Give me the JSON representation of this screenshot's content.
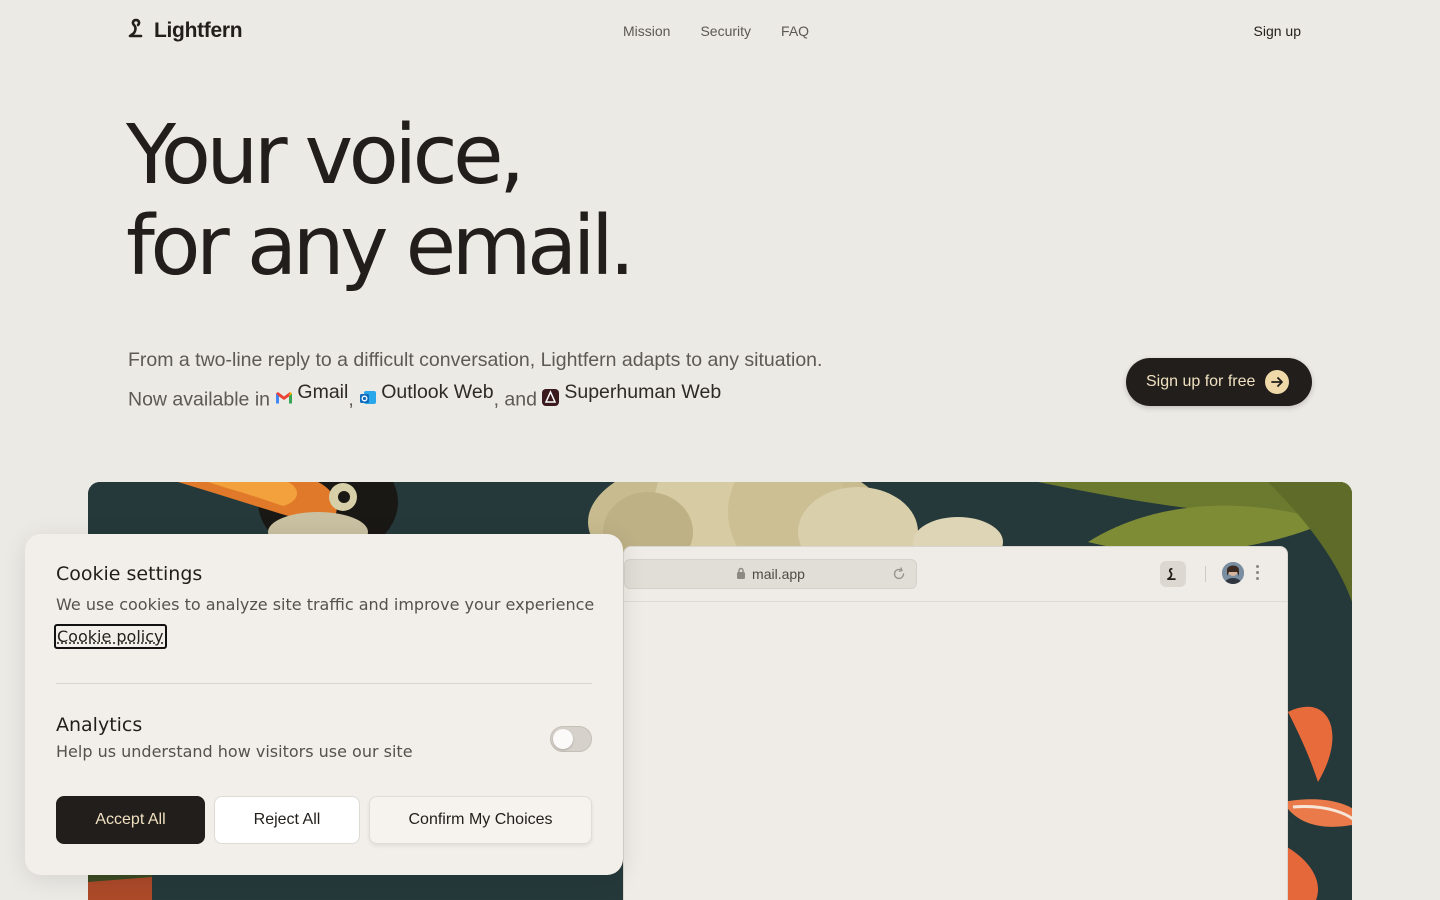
{
  "nav": {
    "logo_text": "Lightfern",
    "links": [
      "Mission",
      "Security",
      "FAQ"
    ],
    "signup": "Sign up"
  },
  "hero": {
    "title_line1": "Your voice,",
    "title_line2": "for any email.",
    "sub_line1": "From a two-line reply to a difficult conversation, Lightfern adapts to any situation.",
    "sub_prefix": "Now available in",
    "product1": "Gmail",
    "product2": "Outlook Web",
    "product3": "Superhuman Web",
    "cta": "Sign up for free"
  },
  "browser": {
    "url": "mail.app"
  },
  "cookie": {
    "title": "Cookie settings",
    "description": "We use cookies to analyze site traffic and improve your experience",
    "policy_link": "Cookie policy",
    "analytics_title": "Analytics",
    "analytics_description": "Help us understand how visitors use our site",
    "analytics_enabled": false,
    "accept": "Accept All",
    "reject": "Reject All",
    "confirm": "Confirm My Choices"
  },
  "colors": {
    "background": "#eceae5",
    "primary_dark": "#221e1b",
    "cta_text": "#efe0c0",
    "art_bg": "#243a3a"
  }
}
